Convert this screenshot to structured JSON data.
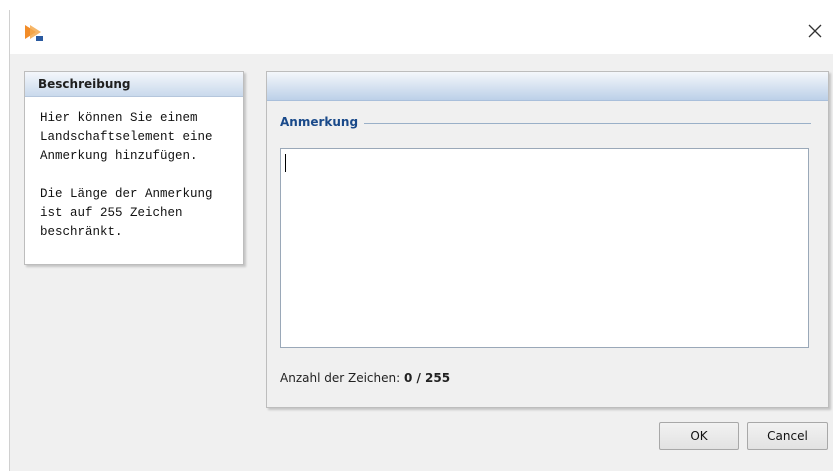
{
  "window": {
    "icon": "app-logo-icon",
    "close_icon": "close-icon"
  },
  "description": {
    "header": "Beschreibung",
    "paragraph1_lines": [
      "Hier können Sie einem",
      "Landschaftselement eine",
      "Anmerkung hinzufügen."
    ],
    "paragraph2_lines": [
      "Die Länge der Anmerkung",
      "ist auf 255 Zeichen",
      "beschränkt."
    ]
  },
  "main": {
    "section_title": "Anmerkung",
    "textarea_value": "",
    "counter_label": "Anzahl der Zeichen:",
    "counter_value": "0 / 255"
  },
  "buttons": {
    "ok": "OK",
    "cancel": "Cancel"
  },
  "colors": {
    "header_gradient_end": "#bcd0e8",
    "legend_text": "#1a4a8a",
    "app_icon_orange": "#f28c28"
  }
}
